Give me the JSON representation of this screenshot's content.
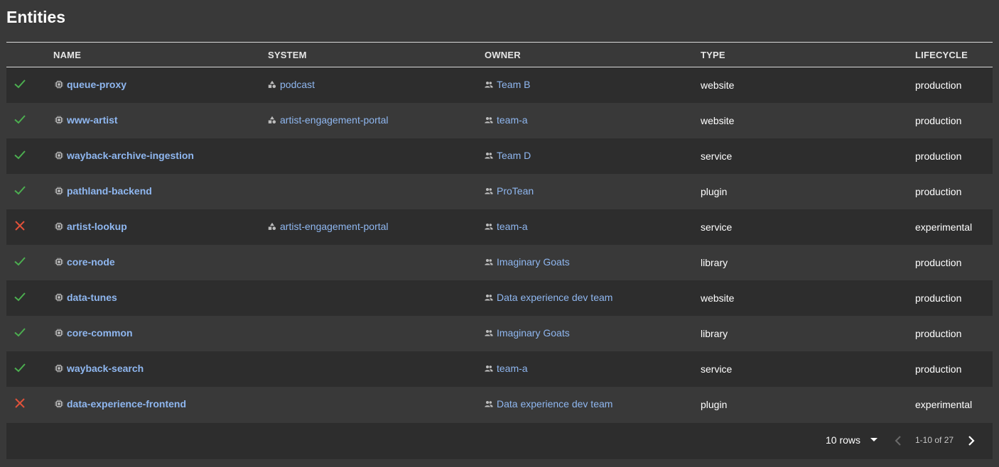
{
  "page": {
    "title": "Entities"
  },
  "table": {
    "columns": [
      "",
      "NAME",
      "SYSTEM",
      "OWNER",
      "TYPE",
      "LIFECYCLE"
    ],
    "rows": [
      {
        "status": "ok",
        "status_icon": "check-icon",
        "name": "queue-proxy",
        "system": "podcast",
        "owner": "Team B",
        "type": "website",
        "lifecycle": "production"
      },
      {
        "status": "ok",
        "status_icon": "check-icon",
        "name": "www-artist",
        "system": "artist-engagement-portal",
        "owner": "team-a",
        "type": "website",
        "lifecycle": "production"
      },
      {
        "status": "ok",
        "status_icon": "check-icon",
        "name": "wayback-archive-ingestion",
        "system": "",
        "owner": "Team D",
        "type": "service",
        "lifecycle": "production"
      },
      {
        "status": "ok",
        "status_icon": "check-icon",
        "name": "pathland-backend",
        "system": "",
        "owner": "ProTean",
        "type": "plugin",
        "lifecycle": "production"
      },
      {
        "status": "error",
        "status_icon": "close-icon",
        "name": "artist-lookup",
        "system": "artist-engagement-portal",
        "owner": "team-a",
        "type": "service",
        "lifecycle": "experimental"
      },
      {
        "status": "ok",
        "status_icon": "check-icon",
        "name": "core-node",
        "system": "",
        "owner": "Imaginary Goats",
        "type": "library",
        "lifecycle": "production"
      },
      {
        "status": "ok",
        "status_icon": "check-icon",
        "name": "data-tunes",
        "system": "",
        "owner": "Data experience dev team",
        "type": "website",
        "lifecycle": "production"
      },
      {
        "status": "ok",
        "status_icon": "check-icon",
        "name": "core-common",
        "system": "",
        "owner": "Imaginary Goats",
        "type": "library",
        "lifecycle": "production"
      },
      {
        "status": "ok",
        "status_icon": "check-icon",
        "name": "wayback-search",
        "system": "",
        "owner": "team-a",
        "type": "service",
        "lifecycle": "production"
      },
      {
        "status": "error",
        "status_icon": "close-icon",
        "name": "data-experience-frontend",
        "system": "",
        "owner": "Data experience dev team",
        "type": "plugin",
        "lifecycle": "experimental"
      }
    ]
  },
  "pagination": {
    "rows_per_page_label": "10 rows",
    "range_label": "1-10 of 27"
  },
  "colors": {
    "ok": "#4caf50",
    "error": "#e0523a",
    "link": "#8fb7f0",
    "row_dark": "#2d2d2d",
    "row_light": "#393939"
  }
}
